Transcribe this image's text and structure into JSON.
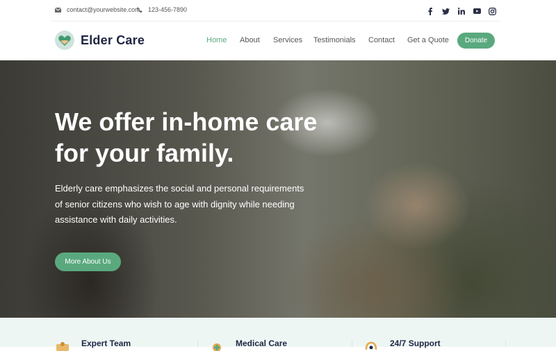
{
  "topbar": {
    "email": "contact@yourwebsite.com",
    "phone": "123-456-7890",
    "social_icons": [
      "facebook-icon",
      "twitter-icon",
      "linkedin-icon",
      "youtube-icon",
      "instagram-icon"
    ]
  },
  "brand": {
    "name": "Elder Care",
    "logo_icon": "heart-icon"
  },
  "nav": {
    "items": [
      "Home",
      "About",
      "Services",
      "Testimonials",
      "Contact",
      "Get a Quote"
    ],
    "active": "Home",
    "donate_label": "Donate"
  },
  "hero": {
    "headline": "We offer in-home care for your family.",
    "description": "Elderly care emphasizes the social and personal requirements of senior citizens who wish to age with dignity while needing assistance with daily activities.",
    "cta_label": "More About Us"
  },
  "features": [
    {
      "title": "Expert Team",
      "icon": "team-icon"
    },
    {
      "title": "Medical Care",
      "icon": "medical-icon"
    },
    {
      "title": "24/7 Support",
      "icon": "support-icon"
    }
  ],
  "colors": {
    "accent": "#5aa97e",
    "brand_text": "#1f2543",
    "features_bg": "#eef6f3"
  }
}
